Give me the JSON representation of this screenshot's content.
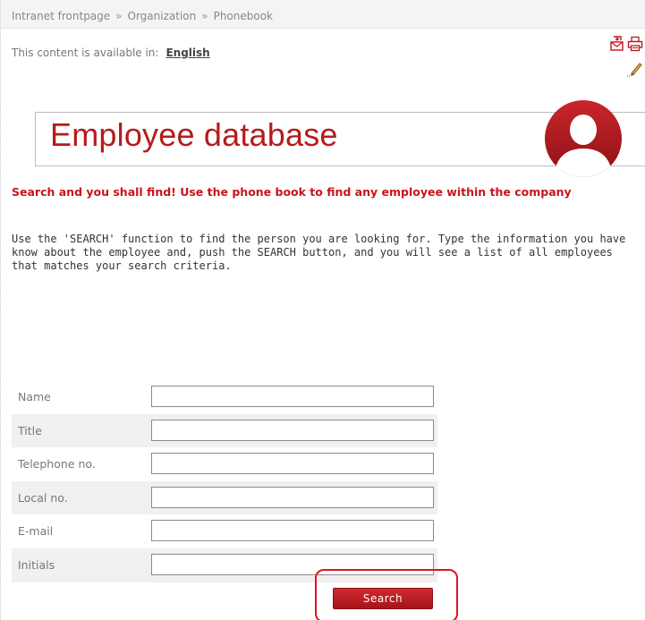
{
  "breadcrumb": {
    "items": [
      "Intranet frontpage",
      "Organization",
      "Phonebook"
    ],
    "separator": "»"
  },
  "language": {
    "prefix": "This content is available in:",
    "current": "English"
  },
  "toolbar": {
    "icons": [
      "send-mail-icon",
      "print-icon",
      "edit-icon"
    ]
  },
  "banner": {
    "title": "Employee database",
    "icon": "person-avatar-icon"
  },
  "intro": {
    "lead": "Search and you shall find! Use the phone book to find any employee within the company",
    "body": "Use the 'SEARCH' function to find the person you are looking for. Type the information you have know about the employee and, push the SEARCH button, and you will see a list of all employees that matches your search criteria."
  },
  "form": {
    "fields": [
      {
        "label": "Name",
        "value": ""
      },
      {
        "label": "Title",
        "value": ""
      },
      {
        "label": "Telephone no.",
        "value": ""
      },
      {
        "label": "Local no.",
        "value": ""
      },
      {
        "label": "E-mail",
        "value": ""
      },
      {
        "label": "Initials",
        "value": ""
      }
    ],
    "search_label": "Search"
  },
  "colors": {
    "brand_red": "#b51b1b",
    "lead_red": "#c8141a",
    "button_red": "#b8191f",
    "highlight_red": "#e0141e"
  }
}
